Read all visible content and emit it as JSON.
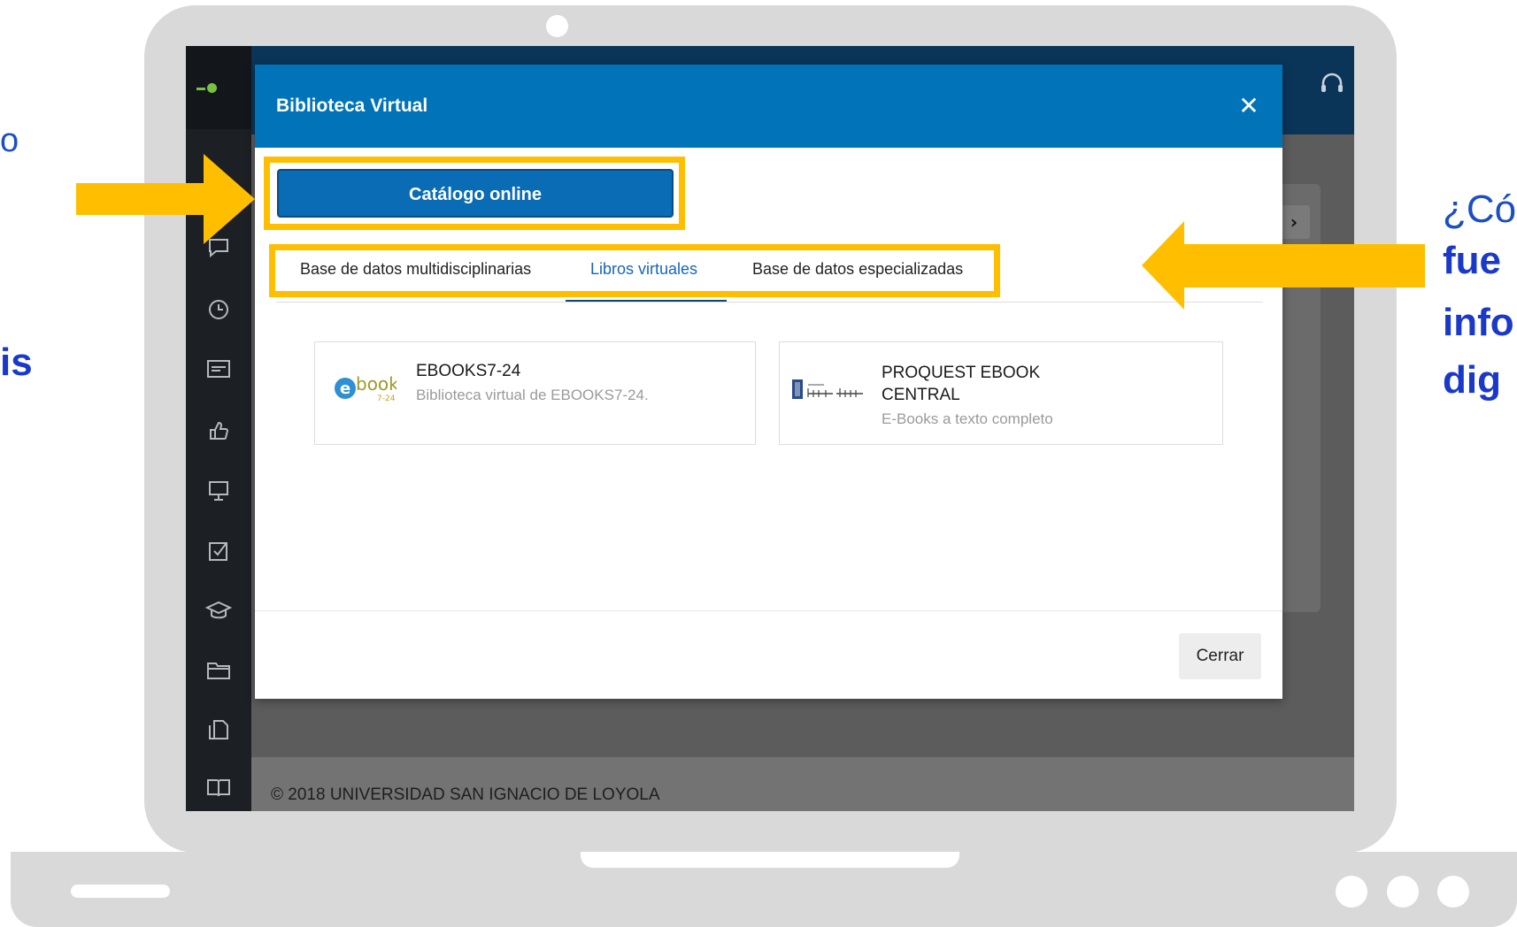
{
  "modal": {
    "title": "Biblioteca Virtual",
    "close_icon": "close-icon",
    "catalog_button": "Catálogo online",
    "tabs": [
      {
        "label": "Base de datos multidisciplinarias",
        "active": false
      },
      {
        "label": "Libros virtuales",
        "active": true
      },
      {
        "label": "Base de datos especializadas",
        "active": false
      }
    ],
    "cards": [
      {
        "title": "EBOOKS7-24",
        "description": "Biblioteca virtual de EBOOKS7-24.",
        "logo": "ebooks-logo"
      },
      {
        "title_line1": "PROQUEST EBOOK",
        "title_line2": "CENTRAL",
        "description": "E-Books a texto completo",
        "logo": "proquest-ebook-central-logo"
      }
    ],
    "close_button": "Cerrar"
  },
  "footer": {
    "copyright": "© 2018 UNIVERSIDAD SAN IGNACIO DE LOYOLA"
  },
  "sidebar": {
    "icons": [
      "chat-icon",
      "clock-icon",
      "card-icon",
      "thumbs-up-icon",
      "presentation-icon",
      "checkbox-icon",
      "graduation-cap-icon",
      "folder-icon",
      "document-icon",
      "book-icon"
    ]
  },
  "side_text": {
    "left_line_1": "o",
    "left_line_2": "is",
    "right_question": "¿Có",
    "right_bold": [
      "fue",
      "info",
      "dig"
    ]
  },
  "colors": {
    "accent": "#0073b9",
    "highlight": "#ffbf00",
    "annotation_text": "#1a39c8"
  }
}
